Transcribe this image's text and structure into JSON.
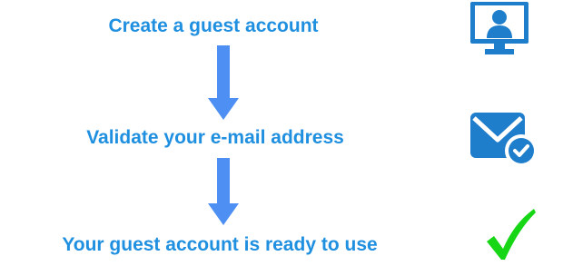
{
  "steps": [
    {
      "label": "Create a guest account",
      "icon": "monitor-user-icon"
    },
    {
      "label": "Validate your e-mail address",
      "icon": "mail-check-icon"
    },
    {
      "label": "Your guest account is ready to use",
      "icon": "green-checkmark-icon"
    }
  ],
  "colors": {
    "text": "#1f8fe0",
    "arrow": "#4d8ff2",
    "icon_blue": "#1f7ecb",
    "check_green": "#16d616"
  }
}
